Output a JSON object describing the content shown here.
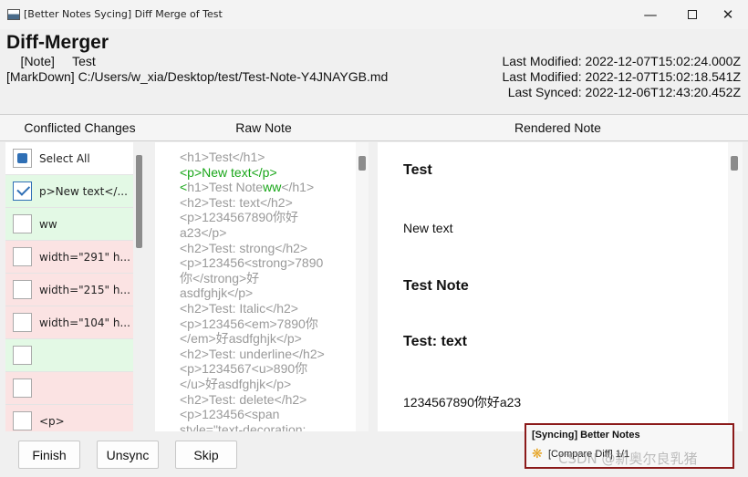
{
  "window": {
    "title": "[Better Notes Sycing] Diff Merge of Test"
  },
  "header": {
    "title": "Diff-Merger",
    "note_line": "    [Note]     Test",
    "markdown_line": "[MarkDown] C:/Users/w_xia/Desktop/test/Test-Note-Y4JNAYGB.md",
    "last_modified_1": "Last Modified: 2022-12-07T15:02:24.000Z",
    "last_modified_2": "Last Modified: 2022-12-07T15:02:18.541Z",
    "last_synced": "Last Synced: 2022-12-06T12:43:20.452Z"
  },
  "columns": {
    "conflicted": "Conflicted Changes",
    "raw": "Raw Note",
    "rendered": "Rendered Note"
  },
  "changes": [
    {
      "label": "Select All",
      "state": "partial",
      "tone": "plain"
    },
    {
      "label": "p>New text</...",
      "state": "checked",
      "tone": "green"
    },
    {
      "label": "ww",
      "state": "unchecked",
      "tone": "green"
    },
    {
      "label": "width=\"291\" h...",
      "state": "unchecked",
      "tone": "red"
    },
    {
      "label": "width=\"215\" h...",
      "state": "unchecked",
      "tone": "red"
    },
    {
      "label": "width=\"104\" h...",
      "state": "unchecked",
      "tone": "red"
    },
    {
      "label": "",
      "state": "unchecked",
      "tone": "green"
    },
    {
      "label": "",
      "state": "unchecked",
      "tone": "red"
    },
    {
      "label": "<p>",
      "state": "unchecked",
      "tone": "red"
    }
  ],
  "raw_note": {
    "lines": [
      "<h1>Test</h1>",
      "<p>New text</p>",
      "<h1>Test Noteww</h1>",
      "<h2>Test: text</h2>",
      "<p>1234567890你好",
      "a23</p>",
      "<h2>Test: strong</h2>",
      "<p>123456<strong>7890",
      "你</strong>好",
      "asdfghjk</p>",
      "<h2>Test: Italic</h2>",
      "<p>123456<em>7890你",
      "</em>好asdfghjk</p>",
      "<h2>Test: underline</h2>",
      "<p>1234567<u>890你",
      "</u>好asdfghjk</p>",
      "<h2>Test: delete</h2>",
      "<p>123456<span",
      "style=\"text-decoration:"
    ],
    "added_line_1": "<p>New text</p>",
    "mixed_line_prefix": "<",
    "mixed_line_middle": "h1>Test Note",
    "mixed_line_added": "ww",
    "mixed_line_suffix": "</h1>"
  },
  "rendered_note": {
    "h1": "Test",
    "p_new": "New text",
    "h1_note": "Test Note",
    "h2_text": "Test: text",
    "p_numbers": "1234567890你好a23"
  },
  "buttons": {
    "finish": "Finish",
    "unsync": "Unsync",
    "skip": "Skip"
  },
  "toast": {
    "title": "[Syncing] Better Notes",
    "body": "[Compare Diff] 1/1"
  },
  "watermark": "CSDN @新奥尔良乳猪",
  "colors": {
    "added_text": "#19a619",
    "row_added_bg": "#e3f9e5",
    "row_removed_bg": "#fbe3e3",
    "accent": "#2f6fb5",
    "toast_border": "#8b1a1a"
  },
  "icons": {
    "app": "window-app-icon",
    "minimize": "minimize-icon",
    "maximize": "maximize-icon",
    "close": "close-icon",
    "toast": "sync-spinner-icon"
  }
}
